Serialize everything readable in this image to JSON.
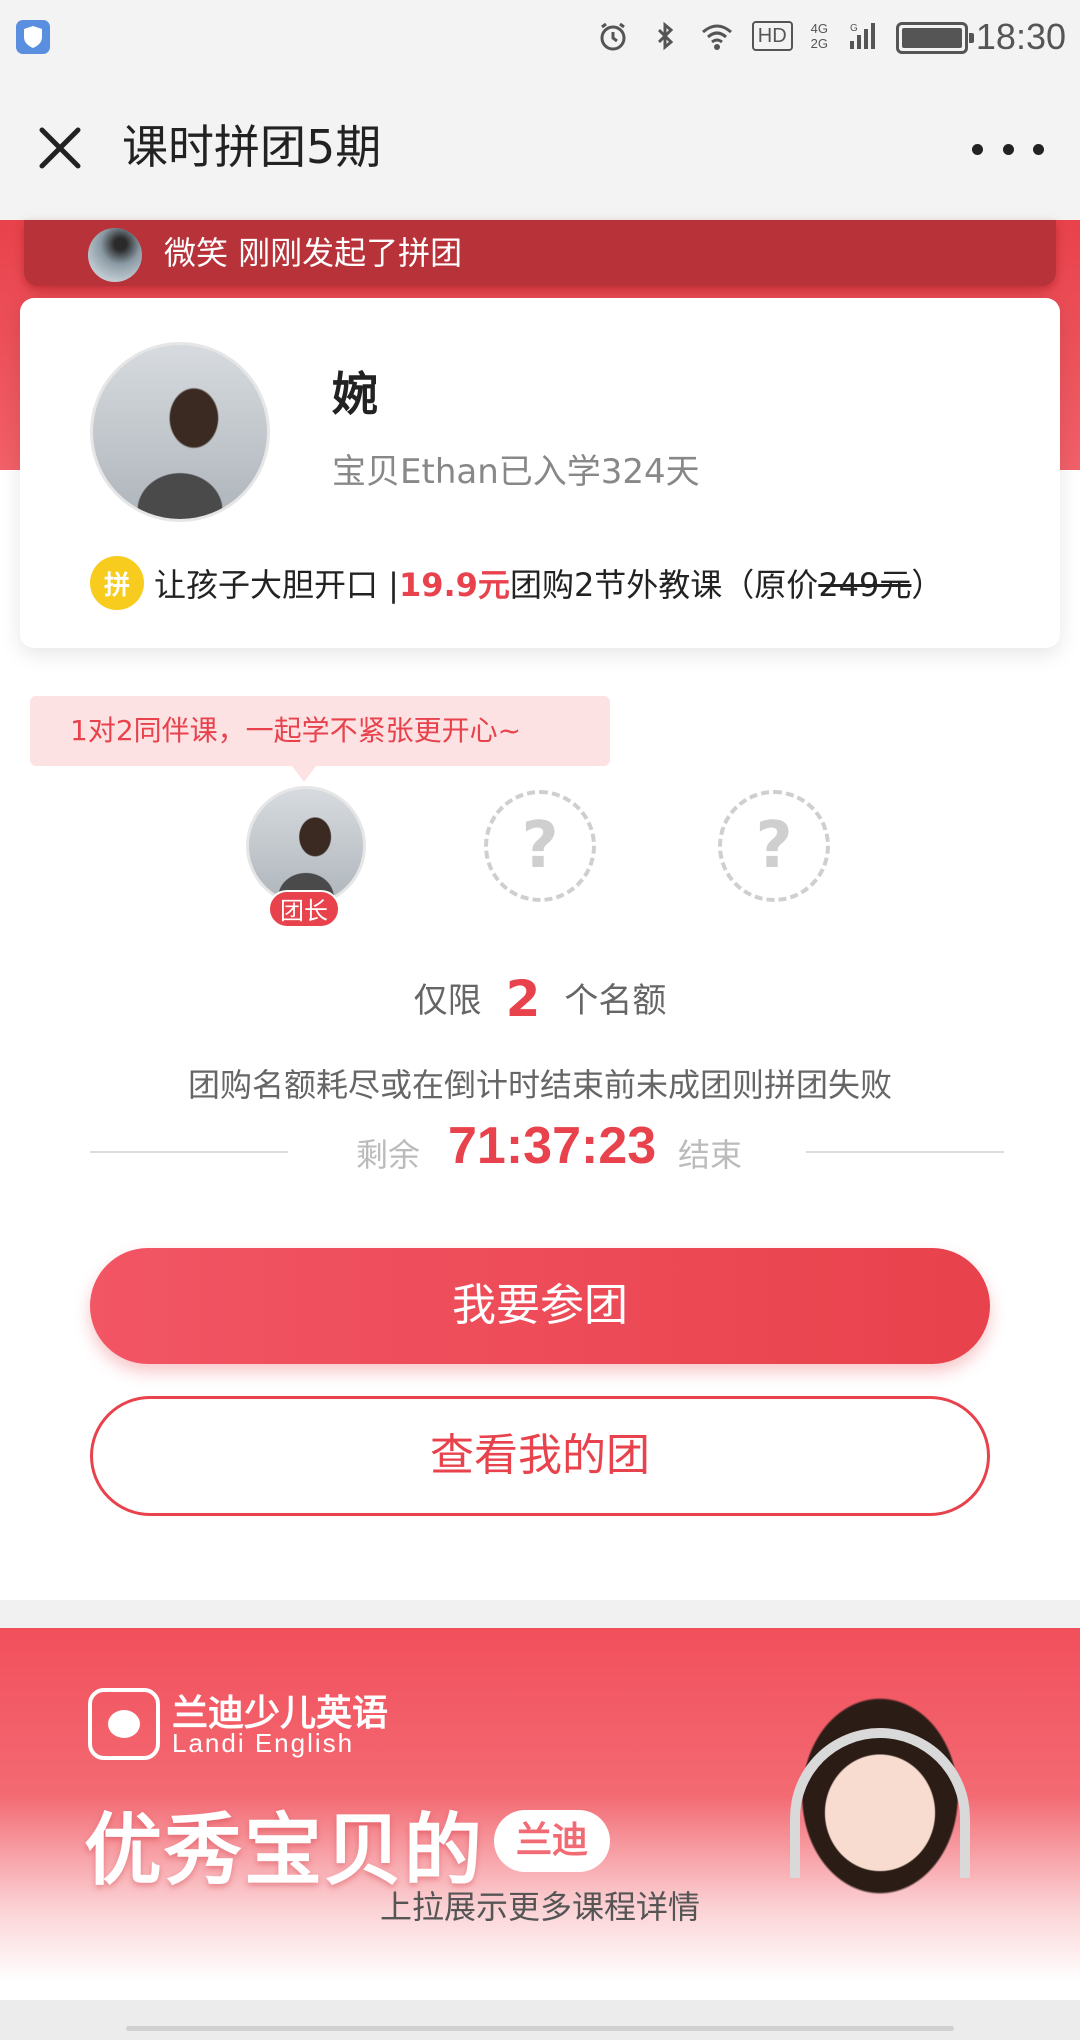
{
  "status_bar": {
    "time": "18:30",
    "hd": "HD",
    "network_top": "4G",
    "network_bottom": "2G",
    "sim_label": "G"
  },
  "title_bar": {
    "title": "课时拼团5期"
  },
  "notification": {
    "text": "微笑 刚刚发起了拼团"
  },
  "profile": {
    "name": "婉",
    "meta": "宝贝Ethan已入学324天",
    "badge": "拼",
    "promo_prefix": "让孩子大胆开口 | ",
    "promo_price": "19.9元",
    "promo_middle": "团购2节外教课（原价",
    "promo_original": "249元",
    "promo_suffix": "）"
  },
  "tooltip": "1对2同伴课，一起学不紧张更开心~",
  "members": {
    "leader_tag": "团长",
    "empty_mark": "?"
  },
  "quota": {
    "prefix": "仅限",
    "count": "2",
    "suffix": "个名额"
  },
  "rule": "团购名额耗尽或在倒计时结束前未成团则拼团失败",
  "countdown": {
    "prefix": "剩余",
    "time": "71:37:23",
    "suffix": "结束"
  },
  "buttons": {
    "join": "我要参团",
    "view": "查看我的团"
  },
  "banner": {
    "brand_cn": "兰迪少儿英语",
    "brand_en": "Landi English",
    "slogan": "优秀宝贝的",
    "pill": "兰迪",
    "pull_hint": "上拉展示更多课程详情"
  },
  "colors": {
    "accent": "#e8424c",
    "badge_yellow": "#f7cc1e"
  }
}
